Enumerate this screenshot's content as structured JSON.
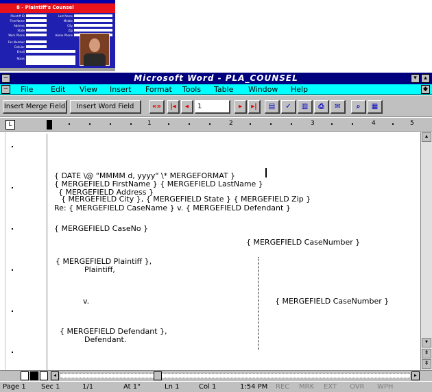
{
  "thumbnail": {
    "title": "8 - Plaintiff's Counsel",
    "fields": [
      "Plaintiff ID",
      "Last Name",
      "First Name",
      "Middle",
      "Address",
      "City",
      "State",
      "Zip",
      "Work Phone",
      "Home Phone",
      "Fax Number",
      "Cellular",
      "Email",
      "Notes"
    ]
  },
  "window": {
    "title": "Microsoft Word - PLA_COUNSEL"
  },
  "menu": {
    "items": [
      "File",
      "Edit",
      "View",
      "Insert",
      "Format",
      "Tools",
      "Table",
      "Window",
      "Help"
    ]
  },
  "toolbar": {
    "insert_merge_field": "Insert Merge Field",
    "insert_word_field": "Insert Word Field",
    "record_value": "1"
  },
  "ruler": {
    "marks": [
      "1",
      "2",
      "3",
      "4",
      "5"
    ]
  },
  "document": {
    "lines": [
      "{ DATE \\@ \"MMMM d, yyyy\" \\* MERGEFORMAT }",
      "{ MERGEFIELD FirstName } { MERGEFIELD LastName }",
      "{ MERGEFIELD Address }",
      "{ MERGEFIELD City }, { MERGEFIELD State } { MERGEFIELD Zip }",
      "Re: { MERGEFIELD CaseName } v. { MERGEFIELD Defendant }",
      "{ MERGEFIELD CaseNo }",
      "{ MERGEFIELD Plaintiff },",
      "Plaintiff,",
      "v.",
      "{ MERGEFIELD CaseNumber }",
      "{ MERGEFIELD Defendant },",
      "Defendant."
    ]
  },
  "status": {
    "page": "Page 1",
    "sec": "Sec 1",
    "pages": "1/1",
    "at": "At 1\"",
    "ln": "Ln 1",
    "col": "Col 1",
    "time": "1:54 PM",
    "rec": "REC",
    "mrk": "MRK",
    "ext": "EXT",
    "ovr": "OVR",
    "wph": "WPH"
  }
}
